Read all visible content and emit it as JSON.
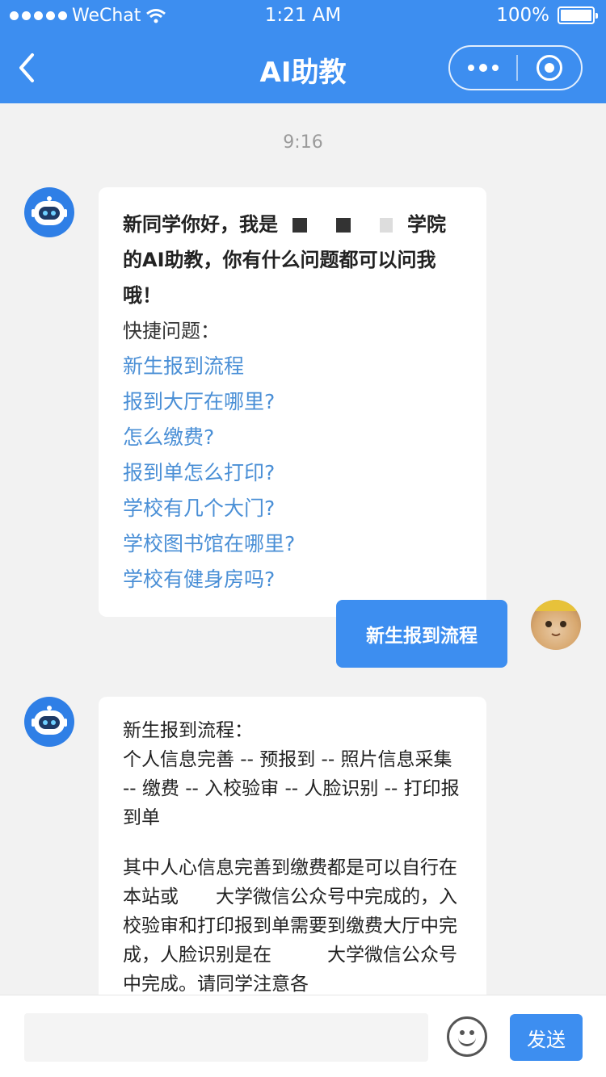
{
  "status_bar": {
    "carrier": "WeChat",
    "time": "1:21 AM",
    "battery_percent": "100%",
    "battery_level": 1.0
  },
  "nav": {
    "title": "AI助教"
  },
  "chat": {
    "timestamp": "9:16",
    "messages": [
      {
        "sender": "bot",
        "intro_part1": "新同学你好，我是",
        "intro_part2": "学院的AI助教，你有什么问题都可以问我哦！",
        "quick_label": "快捷问题：",
        "quick_questions": [
          "新生报到流程",
          "报到大厅在哪里?",
          "怎么缴费?",
          "报到单怎么打印?",
          "学校有几个大门?",
          "学校图书馆在哪里?",
          "学校有健身房吗?"
        ]
      },
      {
        "sender": "user",
        "text": "新生报到流程"
      },
      {
        "sender": "bot",
        "title": "新生报到流程：",
        "steps": "个人信息完善 -- 预报到 -- 照片信息采集 -- 缴费 -- 入校验审 -- 人脸识别 -- 打印报到单",
        "detail": "其中人心信息完善到缴费都是可以自行在本站或　　大学微信公众号中完成的，入校验审和打印报到单需要到缴费大厅中完成，人脸识别是在　　　大学微信公众号中完成。请同学注意各"
      }
    ]
  },
  "input_bar": {
    "placeholder": "",
    "send_label": "发送"
  },
  "colors": {
    "brand_blue": "#3d8ef0",
    "link_blue": "#4a8fd6",
    "background": "#f2f2f2"
  },
  "icons": {
    "back": "chevron-left-icon",
    "more": "more-dots-icon",
    "close": "target-circle-icon",
    "bot_avatar": "robot-icon",
    "emoji": "smiley-icon"
  }
}
